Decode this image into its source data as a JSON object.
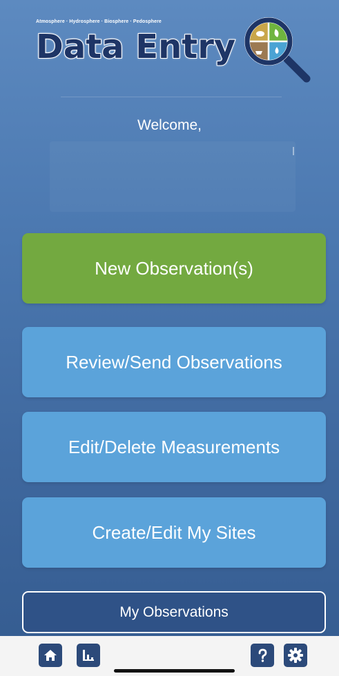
{
  "header": {
    "tagline": "Atmosphere · Hydrosphere · Biosphere · Pedosphere",
    "title": "Data Entry",
    "logo_icon": "magnifier-spheres-icon"
  },
  "welcome": {
    "greeting": "Welcome,",
    "user_name": ""
  },
  "actions": {
    "new_observation": "New Observation(s)",
    "review_send": "Review/Send Observations",
    "edit_delete": "Edit/Delete Measurements",
    "create_edit_sites": "Create/Edit My Sites",
    "my_observations": "My Observations"
  },
  "bottom_nav": {
    "home_icon": "home-icon",
    "chart_icon": "bar-chart-icon",
    "help_icon": "help-icon",
    "settings_icon": "gear-icon"
  },
  "colors": {
    "background_top": "#5d8ac0",
    "background_bottom": "#345b8f",
    "primary_green": "#73a940",
    "button_blue": "#5ba3da",
    "nav_navy": "#2c4a7a",
    "title_navy": "#1e3566"
  }
}
